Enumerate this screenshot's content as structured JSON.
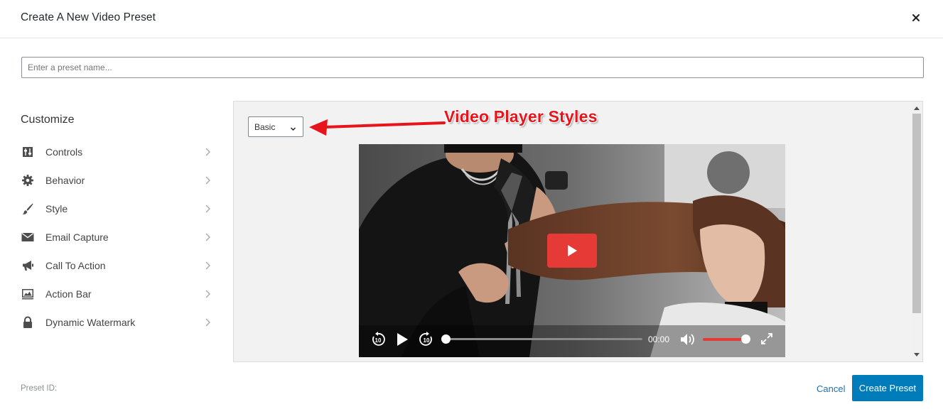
{
  "modal": {
    "title": "Create A New Video Preset",
    "close_icon": "close-icon"
  },
  "preset_name": {
    "value": "",
    "placeholder": "Enter a preset name..."
  },
  "sidebar": {
    "heading": "Customize",
    "items": [
      {
        "label": "Controls",
        "icon": "sliders-icon"
      },
      {
        "label": "Behavior",
        "icon": "gear-icon"
      },
      {
        "label": "Style",
        "icon": "brush-icon"
      },
      {
        "label": "Email Capture",
        "icon": "envelope-icon"
      },
      {
        "label": "Call To Action",
        "icon": "megaphone-icon"
      },
      {
        "label": "Action Bar",
        "icon": "chart-icon"
      },
      {
        "label": "Dynamic Watermark",
        "icon": "lock-icon"
      }
    ]
  },
  "preview": {
    "style_select": {
      "selected": "Basic"
    },
    "annotation": "Video Player Styles",
    "player": {
      "time": "00:00",
      "progress_fraction": 0.0,
      "volume_fraction": 1.0,
      "accent_color": "#e53a35"
    }
  },
  "footer": {
    "preset_id_label": "Preset ID:",
    "cancel_label": "Cancel",
    "create_label": "Create Preset",
    "primary_color": "#007cba",
    "link_color": "#2271b1"
  }
}
